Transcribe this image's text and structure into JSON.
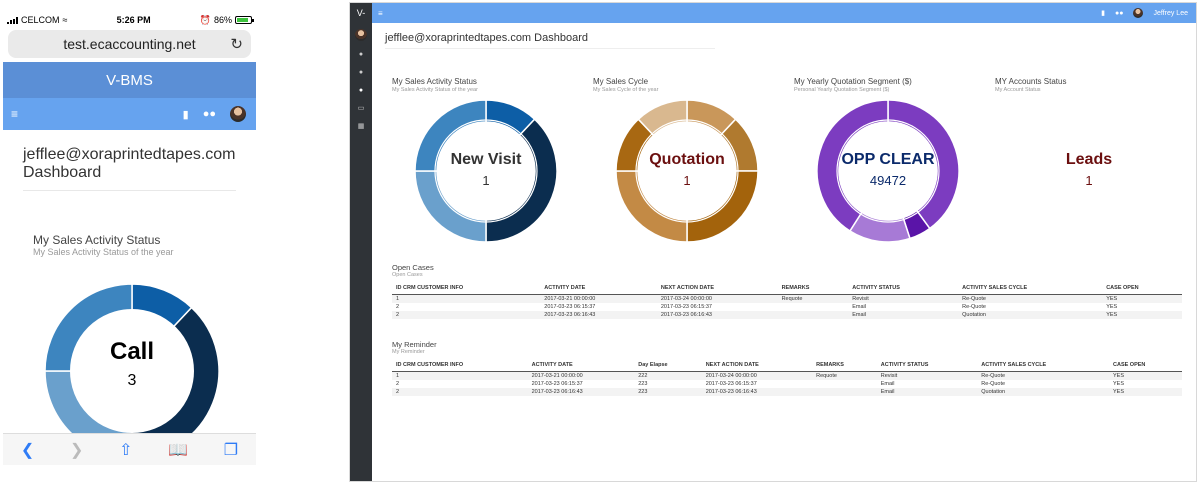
{
  "mobile": {
    "status": {
      "carrier": "CELCOM",
      "time": "5:26 PM",
      "battery": "86%",
      "battery_level": 0.86
    },
    "url": "test.ecaccounting.net",
    "brand": "V-BMS",
    "title_line1": "jefflee@xoraprintedtapes.com",
    "title_line2": "Dashboard",
    "chart": {
      "title": "My Sales Activity Status",
      "subtitle": "My Sales Activity Status of the year",
      "center_label": "Call",
      "center_value": "3"
    },
    "icons": [
      "wifi-icon",
      "alarm-icon",
      "reload-icon",
      "menu-icon",
      "bookmark-icon",
      "users-icon",
      "back-icon",
      "forward-icon",
      "share-icon",
      "book-icon",
      "tabs-icon"
    ]
  },
  "desktop": {
    "brand": "V-",
    "user": "Jeffrey Lee",
    "title": "jefflee@xoraprintedtapes.com Dashboard",
    "charts": [
      {
        "title": "My Sales Activity Status",
        "subtitle": "My Sales Activity Status of the year",
        "center_label": "New Visit",
        "center_value": "1",
        "label_color": "#000000"
      },
      {
        "title": "My Sales Cycle",
        "subtitle": "My Sales Cycle of the year",
        "center_label": "Quotation",
        "center_value": "1",
        "label_color": "#6b0f0f"
      },
      {
        "title": "My Yearly Quotation Segment ($)",
        "subtitle": "Personal Yearly Quotation Segment ($)",
        "center_label": "OPP CLEAR",
        "center_value": "49472",
        "label_color": "#0b2a6b"
      },
      {
        "title": "MY Accounts Status",
        "subtitle": "My Account Status",
        "center_label": "Leads",
        "center_value": "1",
        "label_color": "#6b0f0f"
      }
    ],
    "open_cases": {
      "title": "Open Cases",
      "subtitle": "Open Cases",
      "headers": [
        "ID CRM CUSTOMER INFO",
        "ACTIVITY DATE",
        "NEXT ACTION DATE",
        "REMARKS",
        "ACTIVITY STATUS",
        "ACTIVITY SALES CYCLE",
        "CASE OPEN"
      ],
      "rows": [
        [
          "1",
          "2017-03-21 00:00:00",
          "2017-03-24 00:00:00",
          "Requote",
          "Revisit",
          "Re-Quote",
          "YES"
        ],
        [
          "2",
          "2017-03-23 06:15:37",
          "2017-03-23 06:15:37",
          "",
          "Email",
          "Re-Quote",
          "YES"
        ],
        [
          "2",
          "2017-03-23 06:16:43",
          "2017-03-23 06:16:43",
          "",
          "Email",
          "Quotation",
          "YES"
        ]
      ]
    },
    "reminder": {
      "title": "My Reminder",
      "subtitle": "My Reminder",
      "headers": [
        "ID CRM CUSTOMER INFO",
        "ACTIVITY DATE",
        "Day Elapse",
        "NEXT ACTION DATE",
        "REMARKS",
        "ACTIVITY STATUS",
        "ACTIVITY SALES CYCLE",
        "CASE OPEN"
      ],
      "rows": [
        [
          "1",
          "2017-03-21 00:00:00",
          "222",
          "2017-03-24 00:00:00",
          "Requote",
          "Revisit",
          "Re-Quote",
          "YES"
        ],
        [
          "2",
          "2017-03-23 06:15:37",
          "223",
          "2017-03-23 06:15:37",
          "",
          "Email",
          "Re-Quote",
          "YES"
        ],
        [
          "2",
          "2017-03-23 06:16:43",
          "223",
          "2017-03-23 06:16:43",
          "",
          "Email",
          "Quotation",
          "YES"
        ]
      ]
    }
  },
  "colors": {
    "brand_bar": "#5b8fd6",
    "nav_bar": "#66a3ef",
    "sidebar": "#2f3337",
    "donut_blue": [
      "#0d5ea6",
      "#0b2d4f",
      "#6aa0cc",
      "#3d85bf"
    ],
    "donut_tan": [
      "#c9975a",
      "#b07a2f",
      "#a3630c",
      "#c38a45",
      "#a86812",
      "#d9b88f"
    ],
    "donut_purple": [
      "#7c3cc0",
      "#5a14a8",
      "#a77ad6"
    ],
    "donut_gold": "#a8660e"
  }
}
